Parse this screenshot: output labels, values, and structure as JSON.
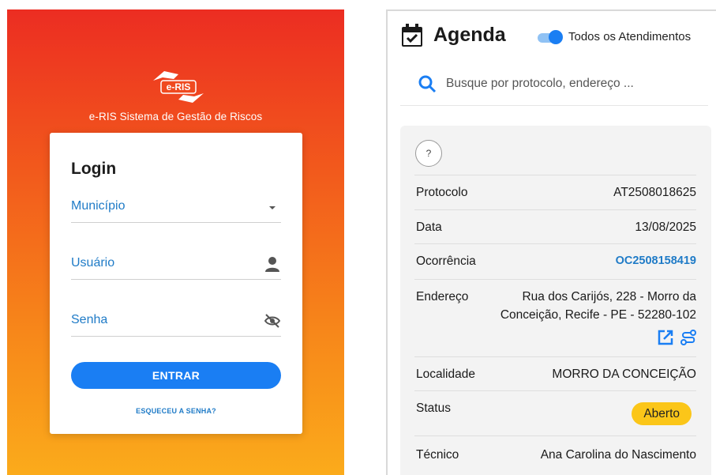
{
  "login": {
    "logo_text": "e-RIS",
    "subtitle": "e-RIS Sistema de Gestão de Riscos",
    "title": "Login",
    "municipio_label": "Município",
    "usuario_label": "Usuário",
    "senha_label": "Senha",
    "enter_button": "ENTRAR",
    "forgot_link": "ESQUECEU A SENHA?",
    "icons": [
      "chevron-down-icon",
      "person-icon",
      "eye-off-icon"
    ],
    "colors": {
      "gradient_top": "#ec2d22",
      "gradient_bottom": "#fbab1b",
      "accent": "#1a7ef3",
      "label": "#1f7bc7"
    }
  },
  "agenda": {
    "title": "Agenda",
    "toggle_label": "Todos os Atendimentos",
    "toggle_on": true,
    "search_placeholder": "Busque por protocolo, endereço ...",
    "help_label": "?",
    "rows": {
      "protocolo": {
        "label": "Protocolo",
        "value": "AT2508018625"
      },
      "data": {
        "label": "Data",
        "value": "13/08/2025"
      },
      "ocorrencia": {
        "label": "Ocorrência",
        "value": "OC2508158419"
      },
      "endereco": {
        "label": "Endereço",
        "line1": "Rua dos Carijós, 228 - Morro da",
        "line2": "Conceição, Recife - PE - 52280-102"
      },
      "localidade": {
        "label": "Localidade",
        "value": "MORRO DA CONCEIÇÃO"
      },
      "status": {
        "label": "Status",
        "value": "Aberto"
      },
      "tecnico": {
        "label": "Técnico",
        "value": "Ana Carolina do Nascimento"
      }
    },
    "icons": [
      "calendar-check-icon",
      "search-icon",
      "open-in-new-icon",
      "route-icon"
    ],
    "colors": {
      "accent": "#1a7ef3",
      "link": "#1f7bc7",
      "status_badge": "#fbc619"
    }
  }
}
